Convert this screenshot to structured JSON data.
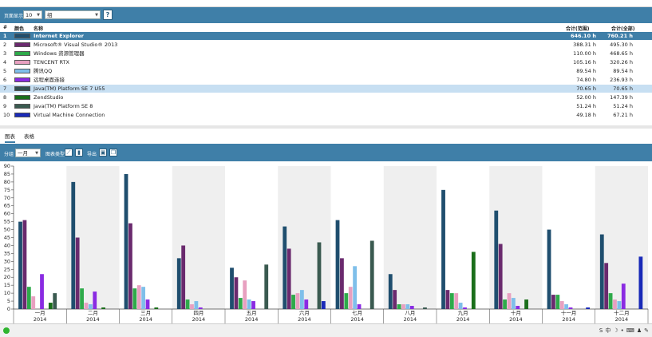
{
  "display": {
    "label": "页面显示",
    "count": "10",
    "group": "组",
    "help": "?"
  },
  "table": {
    "headers": {
      "idx": "#",
      "color": "颜色",
      "name": "名称",
      "range": "合计(范围)",
      "all": "合计(全部)"
    },
    "rows": [
      {
        "idx": "1",
        "color": "#1f4e6e",
        "name": "Internet Explorer",
        "range": "646.10 h",
        "all": "760.21 h"
      },
      {
        "idx": "2",
        "color": "#6a2a6e",
        "name": "Microsoft® Visual Studio® 2013",
        "range": "388.31 h",
        "all": "495.30 h"
      },
      {
        "idx": "3",
        "color": "#2eaa4a",
        "name": "Windows 资源管理器",
        "range": "110.00 h",
        "all": "468.65 h"
      },
      {
        "idx": "4",
        "color": "#e8a0c0",
        "name": "TENCENT RTX",
        "range": "105.16 h",
        "all": "320.26 h"
      },
      {
        "idx": "5",
        "color": "#7fbfea",
        "name": "腾讯QQ",
        "range": "89.54 h",
        "all": "89.54 h"
      },
      {
        "idx": "6",
        "color": "#8a2be2",
        "name": "远程桌面连接",
        "range": "74.80 h",
        "all": "236.93 h"
      },
      {
        "idx": "7",
        "color": "#2f4f4f",
        "name": "Java(TM) Platform SE 7 U55",
        "range": "70.65 h",
        "all": "70.65 h"
      },
      {
        "idx": "8",
        "color": "#1a6e1a",
        "name": "ZendStudio",
        "range": "52.00 h",
        "all": "147.39 h"
      },
      {
        "idx": "9",
        "color": "#3a5a50",
        "name": "Java(TM) Platform SE 8",
        "range": "51.24 h",
        "all": "51.24 h"
      },
      {
        "idx": "10",
        "color": "#1a2ab8",
        "name": "Virtual Machine Connection",
        "range": "49.18 h",
        "all": "67.21 h"
      }
    ]
  },
  "tabs": {
    "chart": "图表",
    "table": "表格"
  },
  "chart_toolbar": {
    "group_label": "分组",
    "group_value": "一月",
    "chart_type_label": "图表类型",
    "export_label": "导出"
  },
  "chart_data": {
    "type": "bar",
    "categories": [
      "一月",
      "二月",
      "三月",
      "四月",
      "五月",
      "六月",
      "七月",
      "八月",
      "九月",
      "十月",
      "十一月",
      "十二月"
    ],
    "year": "2014",
    "ylim": [
      0,
      90
    ],
    "yticks": [
      0,
      5,
      10,
      15,
      20,
      25,
      30,
      35,
      40,
      45,
      50,
      55,
      60,
      65,
      70,
      75,
      80,
      85,
      90
    ],
    "series_colors": [
      "#1f4e6e",
      "#6a2a6e",
      "#2eaa4a",
      "#e8a0c0",
      "#7fbfea",
      "#8a2be2",
      "#2f4f4f",
      "#1a6e1a",
      "#3a5a50",
      "#1a2ab8"
    ],
    "series": [
      {
        "name": "Internet Explorer",
        "values": [
          55,
          80,
          85,
          32,
          26,
          52,
          56,
          22,
          75,
          62,
          50,
          47
        ]
      },
      {
        "name": "Microsoft® Visual Studio® 2013",
        "values": [
          56,
          45,
          54,
          40,
          20,
          38,
          32,
          12,
          12,
          41,
          9,
          29
        ]
      },
      {
        "name": "Windows 资源管理器",
        "values": [
          14,
          13,
          13,
          6,
          7,
          9,
          10,
          3,
          10,
          6,
          9,
          10
        ]
      },
      {
        "name": "TENCENT RTX",
        "values": [
          8,
          4,
          15,
          3,
          18,
          10,
          14,
          3,
          10,
          10,
          5,
          6
        ]
      },
      {
        "name": "腾讯QQ",
        "values": [
          0,
          3,
          14,
          5,
          6,
          12,
          27,
          3,
          4,
          7,
          3,
          5
        ]
      },
      {
        "name": "远程桌面连接",
        "values": [
          22,
          11,
          6,
          1,
          5,
          6,
          3,
          2,
          1,
          2,
          1,
          16
        ]
      },
      {
        "name": "Java(TM) Platform SE 7 U55",
        "values": [
          0,
          0,
          0,
          0,
          0,
          0,
          0,
          0,
          0,
          0,
          0,
          0
        ]
      },
      {
        "name": "ZendStudio",
        "values": [
          4,
          1,
          1,
          0,
          0,
          0,
          0,
          0,
          36,
          6,
          0,
          0
        ]
      },
      {
        "name": "Java(TM) Platform SE 8",
        "values": [
          10,
          0,
          0,
          0,
          28,
          42,
          43,
          1,
          0,
          0,
          0,
          0
        ]
      },
      {
        "name": "Virtual Machine Connection",
        "values": [
          0,
          0,
          0,
          0,
          0,
          5,
          0,
          0,
          0,
          0,
          1,
          33
        ]
      }
    ]
  }
}
